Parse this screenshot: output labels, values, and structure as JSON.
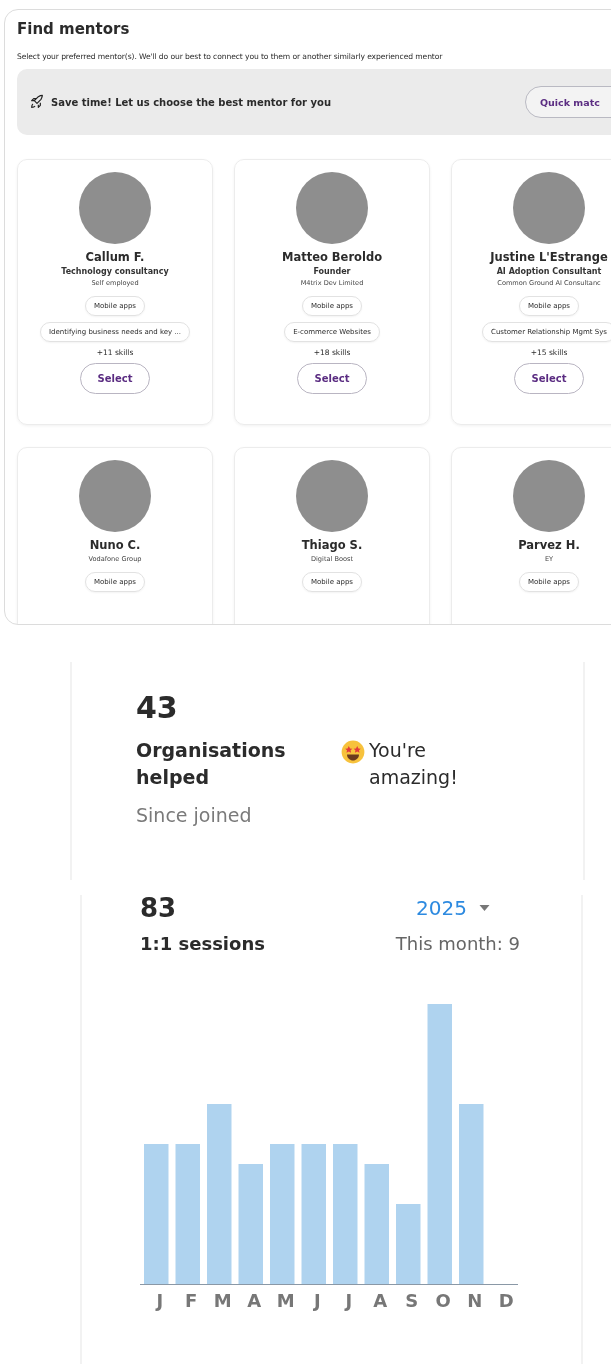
{
  "mentors": {
    "title": "Find mentors",
    "subtitle": "Select your preferred mentor(s). We'll do our best to connect you to them or another similarly experienced mentor",
    "banner": {
      "text": "Save time! Let us choose the best mentor for you",
      "button": "Quick matc"
    },
    "cards": [
      {
        "name": "Callum F.",
        "role": "Technology consultancy",
        "company": "Self employed",
        "skills": [
          "Mobile apps",
          "Identifying business needs and key ..."
        ],
        "more_skills": "+11 skills",
        "button": "Select"
      },
      {
        "name": "Matteo Beroldo",
        "role": "Founder",
        "company": "M4trix Dev Limited",
        "skills": [
          "Mobile apps",
          "E-commerce Websites"
        ],
        "more_skills": "+18 skills",
        "button": "Select"
      },
      {
        "name": "Justine L'Estrange",
        "role": "AI Adoption Consultant",
        "company": "Common Ground AI Consultanc",
        "skills": [
          "Mobile apps",
          "Customer Relationship Mgmt Sys"
        ],
        "more_skills": "+15 skills",
        "button": "Select"
      },
      {
        "name": "Nuno C.",
        "company": "Vodafone Group",
        "skills": [
          "Mobile apps"
        ]
      },
      {
        "name": "Thiago S.",
        "company": "Digital Boost",
        "skills": [
          "Mobile apps"
        ]
      },
      {
        "name": "Parvez H.",
        "company": "EY",
        "skills": [
          "Mobile apps"
        ]
      }
    ]
  },
  "organisations": {
    "value": "43",
    "label": "Organisations helped",
    "praise": "You're amazing!",
    "note": "Since joined"
  },
  "sessions": {
    "value": "83",
    "year": "2025",
    "label": "1:1 sessions",
    "this_month": "This month: 9",
    "months": [
      "J",
      "F",
      "M",
      "A",
      "M",
      "J",
      "J",
      "A",
      "S",
      "O",
      "N",
      "D"
    ]
  }
}
